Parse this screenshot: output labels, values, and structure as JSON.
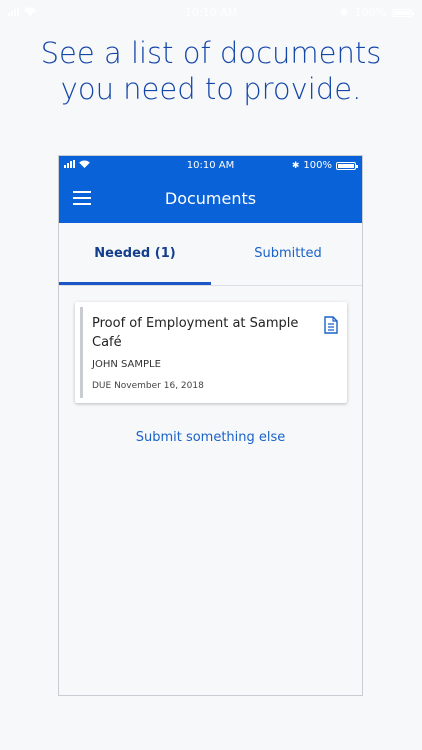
{
  "outer_status": {
    "time": "10:10 AM",
    "battery": "100%"
  },
  "headline": {
    "line1": "See a list of documents",
    "line2": "you need to provide."
  },
  "phone": {
    "status": {
      "time": "10:10 AM",
      "battery": "100%"
    },
    "title": "Documents",
    "tabs": [
      {
        "label": "Needed (1)",
        "active": true
      },
      {
        "label": "Submitted",
        "active": false
      }
    ],
    "documents": [
      {
        "title": "Proof of Employment at Sample Café",
        "name": "JOHN SAMPLE",
        "due": "DUE November 16, 2018"
      }
    ],
    "submit_other": "Submit something else"
  },
  "colors": {
    "accent": "#0a62d8",
    "headline": "#1446a8",
    "link": "#1a62c8"
  },
  "icons": [
    "signal-icon",
    "wifi-icon",
    "bluetooth-icon",
    "battery-icon",
    "menu-icon",
    "document-icon"
  ]
}
